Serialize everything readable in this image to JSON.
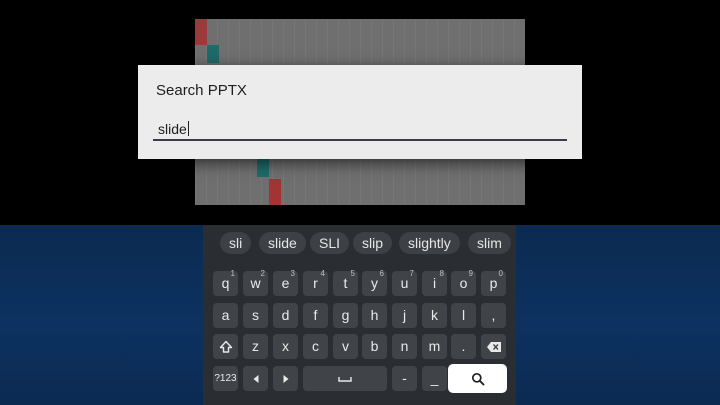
{
  "dialog": {
    "title": "Search PPTX",
    "input_value": "slide"
  },
  "suggestions": [
    "sli",
    "slide",
    "SLI",
    "slip",
    "slightly",
    "slim"
  ],
  "keyboard": {
    "row1": [
      {
        "label": "q",
        "hint": "1"
      },
      {
        "label": "w",
        "hint": "2"
      },
      {
        "label": "e",
        "hint": "3"
      },
      {
        "label": "r",
        "hint": "4"
      },
      {
        "label": "t",
        "hint": "5"
      },
      {
        "label": "y",
        "hint": "6"
      },
      {
        "label": "u",
        "hint": "7"
      },
      {
        "label": "i",
        "hint": "8"
      },
      {
        "label": "o",
        "hint": "9"
      },
      {
        "label": "p",
        "hint": "0"
      }
    ],
    "row2": [
      "a",
      "s",
      "d",
      "f",
      "g",
      "h",
      "j",
      "k",
      "l",
      ","
    ],
    "row3": [
      "z",
      "x",
      "c",
      "v",
      "b",
      "n",
      "m",
      "."
    ],
    "symbols_label": "?123",
    "dash_label": "-",
    "underscore_label": "_",
    "icons": {
      "shift": "shift-icon",
      "backspace": "backspace-icon",
      "left": "arrow-left-icon",
      "right": "arrow-right-icon",
      "space": "space-icon",
      "search": "search-icon"
    }
  },
  "colors": {
    "background": "#000000",
    "keyboard": "#2a2d31",
    "key": "#404449",
    "lower_panel": "#0d3261",
    "dialog": "#ececec"
  }
}
